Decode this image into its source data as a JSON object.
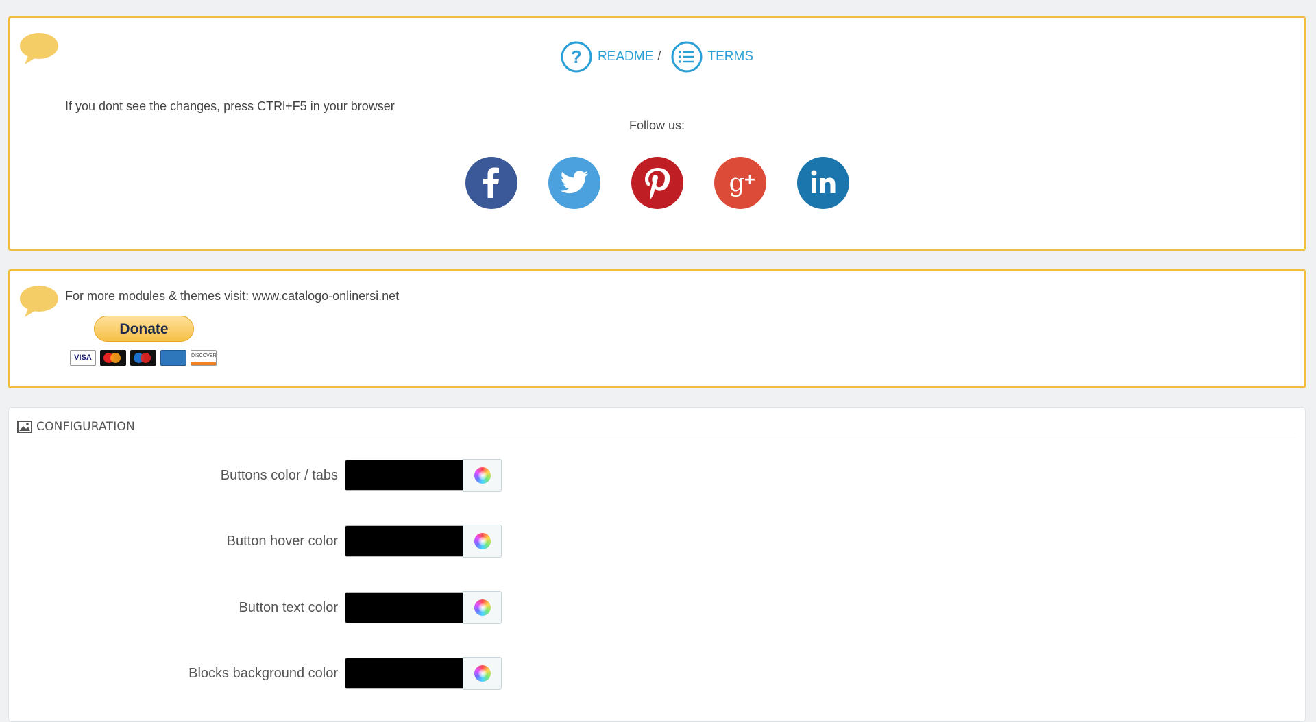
{
  "top_panel": {
    "links": [
      {
        "label": "README",
        "icon": "question-circle-icon"
      },
      {
        "label": "TERMS",
        "icon": "list-circle-icon"
      }
    ],
    "separator": "/",
    "hint": "If you dont see the changes, press CTRl+F5 in your browser",
    "follow_label": "Follow us:",
    "socials": [
      {
        "name": "facebook-icon",
        "color": "#3b5998"
      },
      {
        "name": "twitter-icon",
        "color": "#4aa1dd"
      },
      {
        "name": "pinterest-icon",
        "color": "#bf1f24"
      },
      {
        "name": "google-plus-icon",
        "color": "#dc4a38"
      },
      {
        "name": "linkedin-icon",
        "color": "#1b76ad"
      }
    ]
  },
  "promo_panel": {
    "text": "For more modules & themes visit: www.catalogo-onlinersi.net",
    "donate_label": "Donate",
    "card_visa": "VISA",
    "card_discover": "DISCOVER"
  },
  "config": {
    "title": "CONFIGURATION",
    "fields": [
      {
        "label": "Buttons color / tabs",
        "value": "#000000"
      },
      {
        "label": "Button hover color",
        "value": "#000000"
      },
      {
        "label": "Button text color",
        "value": "#000000"
      },
      {
        "label": "Blocks background color",
        "value": "#000000"
      }
    ]
  },
  "colors": {
    "panel_border": "#f0be3f",
    "link": "#2ba0d8",
    "bubble": "#f5cd67"
  }
}
